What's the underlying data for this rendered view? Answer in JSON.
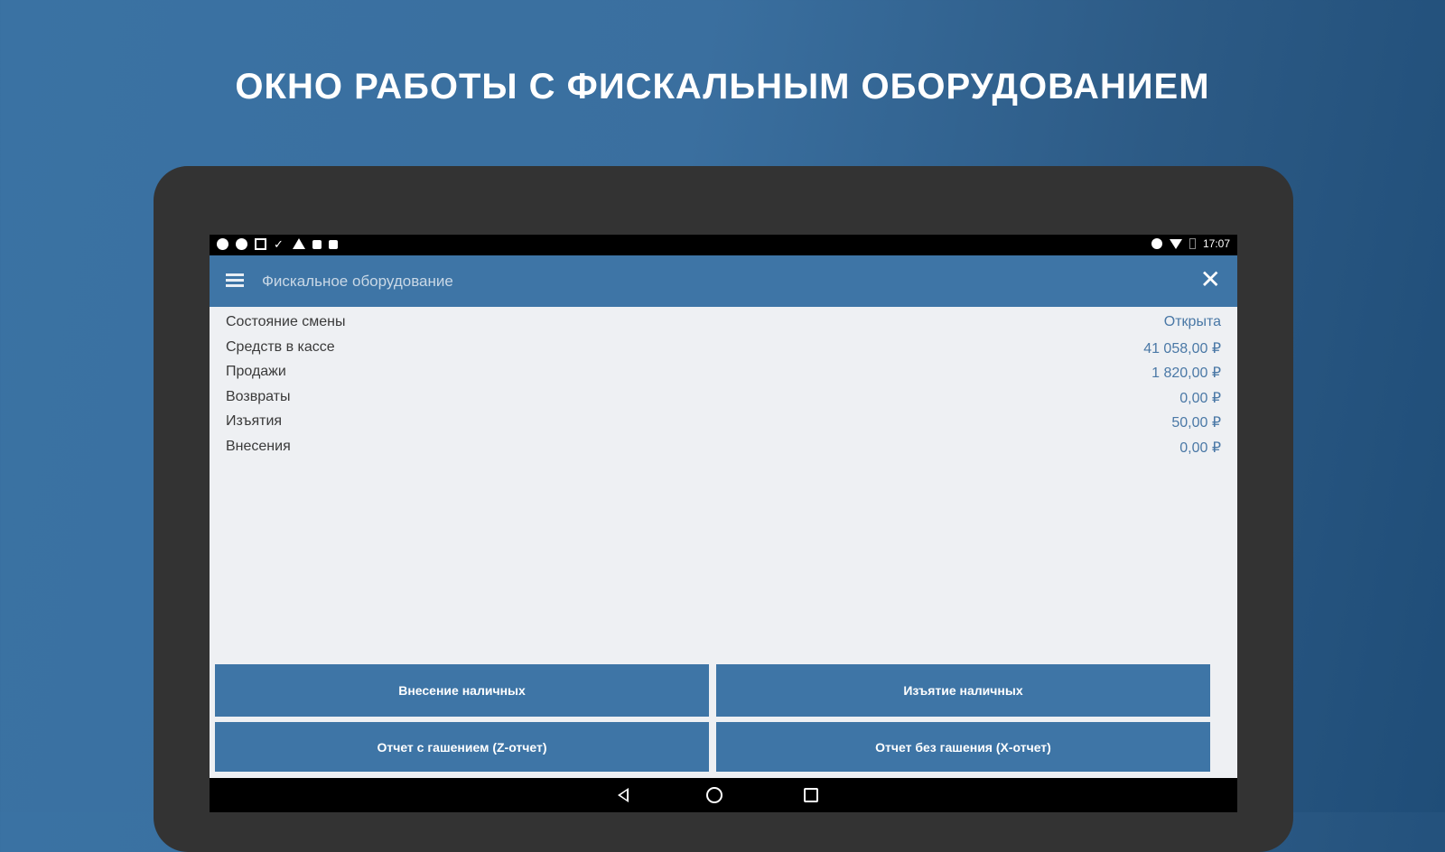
{
  "promo": {
    "title": "ОКНО РАБОТЫ С ФИСКАЛЬНЫМ ОБОРУДОВАНИЕМ"
  },
  "status_bar": {
    "left_icons": [
      "settings-icon",
      "settings-icon",
      "image-icon",
      "check-icon",
      "warning-icon",
      "notification-icon",
      "notification-icon"
    ],
    "right_icons": [
      "alarm-icon",
      "wifi-icon",
      "battery-icon"
    ],
    "time": "17:07"
  },
  "app_bar": {
    "title": "Фискальное оборудование"
  },
  "info": {
    "rows": [
      {
        "label": "Состояние смены",
        "value": "Открыта"
      },
      {
        "label": "Средств в кассе",
        "value": "41 058,00 ₽"
      },
      {
        "label": "Продажи",
        "value": "1 820,00 ₽"
      },
      {
        "label": "Возвраты",
        "value": "0,00 ₽"
      },
      {
        "label": "Изъятия",
        "value": "50,00 ₽"
      },
      {
        "label": "Внесения",
        "value": "0,00 ₽"
      }
    ]
  },
  "buttons": {
    "deposit": "Внесение наличных",
    "withdraw": "Изъятие наличных",
    "z_report": "Отчет с гашением (Z-отчет)",
    "x_report": "Отчет без гашения (X-отчет)"
  },
  "colors": {
    "accent": "#3e75a6",
    "value_text": "#4a78a6",
    "background": "#eef0f3"
  }
}
